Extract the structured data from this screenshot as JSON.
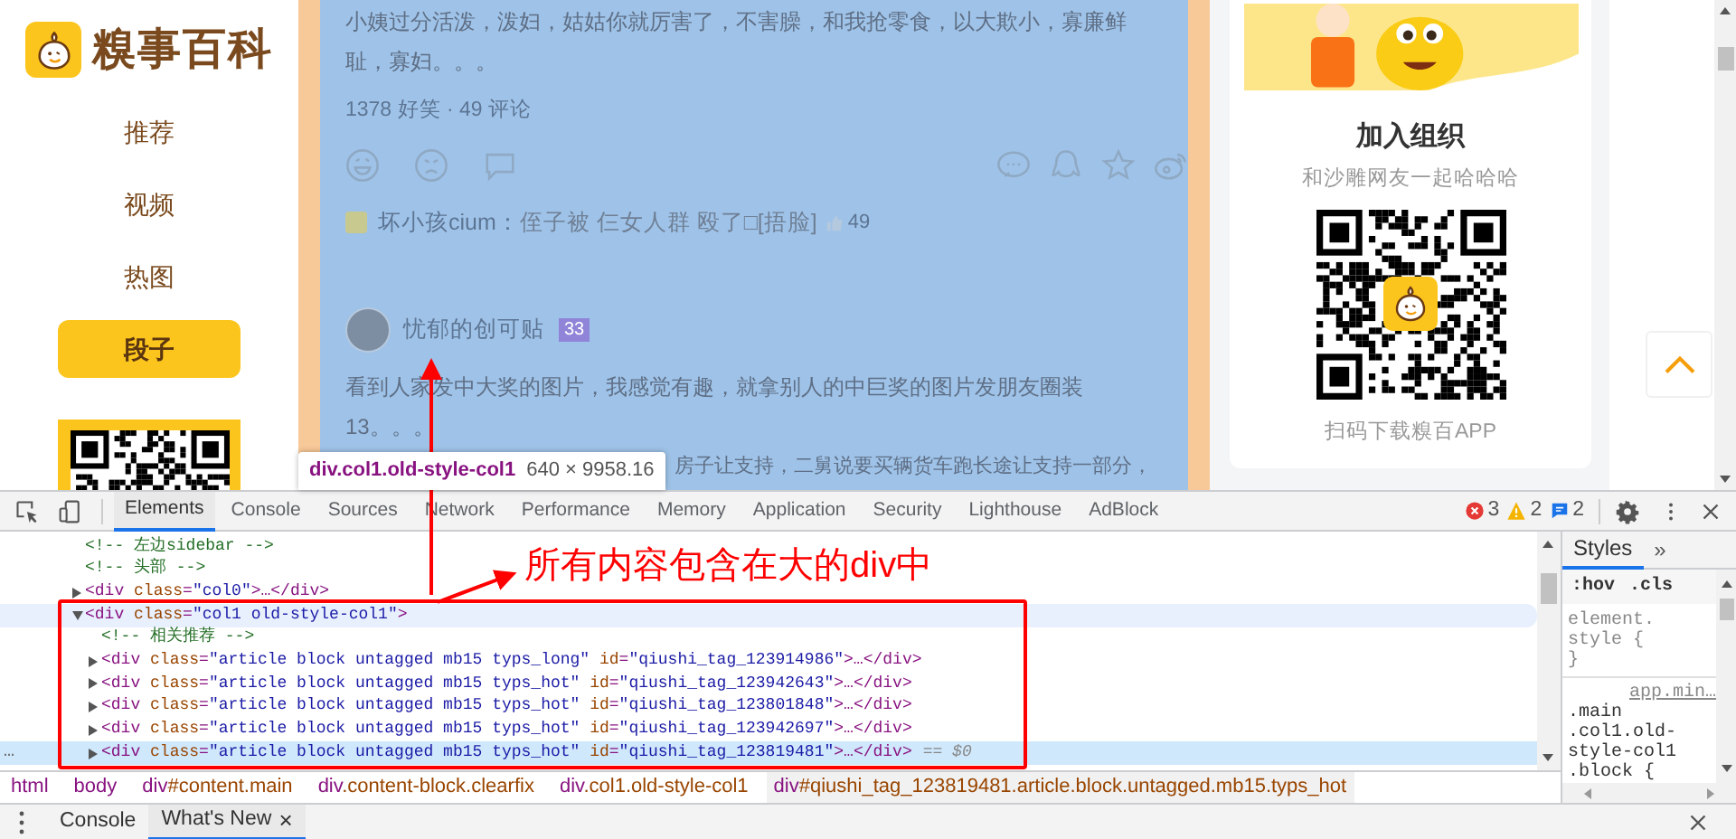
{
  "site": {
    "logo": "糗事百科",
    "nav": [
      {
        "label": "推荐",
        "selected": false
      },
      {
        "label": "视频",
        "selected": false
      },
      {
        "label": "热图",
        "selected": false
      },
      {
        "label": "段子",
        "selected": true
      }
    ],
    "post": {
      "lines": [
        "小姨过分活泼，泼妇，姑姑你就厉害了，不害臊，和我抢零食，以大欺小，寡廉鲜",
        "耻，寡妇。。。"
      ],
      "stats": "1378 好笑 · 49 评论",
      "comment": {
        "user": "坏小孩cium：",
        "text": "侄子被 仨女人群 殴了□[捂脸]",
        "likes": "49"
      }
    },
    "next_post": {
      "author": "忧郁的创可贴",
      "badge": "33",
      "lines": [
        "看到人家发中大奖的图片，我感觉有趣，就拿别人的中巨奖的图片发朋友圈装",
        "13。。。",
        "房子让支持，二舅说要买辆货车跑长途让支持一部分，"
      ]
    },
    "promo": {
      "title": "加入组织",
      "subtitle": "和沙雕网友一起哈哈哈",
      "caption": "扫码下载糗百APP"
    }
  },
  "tooltip": {
    "selector": "div.col1.old-style-col1",
    "size": "640 × 9958.16"
  },
  "devtools": {
    "tabs": [
      {
        "label": "Elements",
        "selected": true
      },
      {
        "label": "Console",
        "selected": false
      },
      {
        "label": "Sources",
        "selected": false
      },
      {
        "label": "Network",
        "selected": false
      },
      {
        "label": "Performance",
        "selected": false
      },
      {
        "label": "Memory",
        "selected": false
      },
      {
        "label": "Application",
        "selected": false
      },
      {
        "label": "Security",
        "selected": false
      },
      {
        "label": "Lighthouse",
        "selected": false
      },
      {
        "label": "AdBlock",
        "selected": false
      }
    ],
    "errors": "3",
    "warnings": "2",
    "infos": "2",
    "dom": [
      {
        "kind": "comment",
        "text": "<!-- 左边sidebar -->",
        "selected": false,
        "hovered": false
      },
      {
        "kind": "comment",
        "text": "<!-- 头部 -->",
        "selected": false,
        "hovered": false
      },
      {
        "kind": "element",
        "text": "<div class=\"col0\">…</div>",
        "expanded": false,
        "selected": false,
        "hovered": false
      },
      {
        "kind": "element",
        "text": "<div class=\"col1 old-style-col1\">",
        "expanded": true,
        "selected": false,
        "hovered": true,
        "children": [
          {
            "kind": "comment",
            "text": "<!-- 相关推荐 -->",
            "selected": false,
            "hovered": false
          },
          {
            "kind": "element",
            "text": "<div class=\"article block untagged mb15 typs_long\" id=\"qiushi_tag_123914986\">…</div>",
            "expanded": false,
            "selected": false,
            "hovered": false
          },
          {
            "kind": "element",
            "text": "<div class=\"article block untagged mb15 typs_hot\" id=\"qiushi_tag_123942643\">…</div>",
            "expanded": false,
            "selected": false,
            "hovered": false
          },
          {
            "kind": "element",
            "text": "<div class=\"article block untagged mb15 typs_hot\" id=\"qiushi_tag_123801848\">…</div>",
            "expanded": false,
            "selected": false,
            "hovered": false
          },
          {
            "kind": "element",
            "text": "<div class=\"article block untagged mb15 typs_hot\" id=\"qiushi_tag_123942697\">…</div>",
            "expanded": false,
            "selected": false,
            "hovered": false
          },
          {
            "kind": "element",
            "text": "<div class=\"article block untagged mb15 typs_hot\" id=\"qiushi_tag_123819481\">…</div>",
            "expanded": false,
            "selected": true,
            "hovered": false,
            "console_ref": "== $0"
          }
        ]
      }
    ],
    "gutter": "…",
    "breadcrumbs": [
      {
        "tag": "html",
        "selected": false
      },
      {
        "tag": "body",
        "selected": false
      },
      {
        "tag": "div",
        "rest": "#content.main",
        "selected": false
      },
      {
        "tag": "div",
        "rest": ".content-block.clearfix",
        "selected": false
      },
      {
        "tag": "div",
        "rest": ".col1.old-style-col1",
        "selected": false
      },
      {
        "tag": "div",
        "rest": "#qiushi_tag_123819481.article.block.untagged.mb15.typs_hot",
        "selected": true
      }
    ],
    "styles": {
      "tabs": [
        "Styles",
        "»"
      ],
      "filters": [
        ":hov",
        ".cls"
      ],
      "rule1": [
        "element.",
        "style {",
        "}"
      ],
      "source": "app.min…",
      "rule2": [
        ".main",
        ".col1.old-",
        "style-col1",
        ".block {"
      ]
    },
    "drawer_tabs": [
      {
        "label": "Console",
        "selected": false,
        "closable": false
      },
      {
        "label": "What's New",
        "selected": true,
        "closable": true
      }
    ],
    "close_glyph": "×"
  },
  "annotation": {
    "text": "所有内容包含在大的div中"
  }
}
